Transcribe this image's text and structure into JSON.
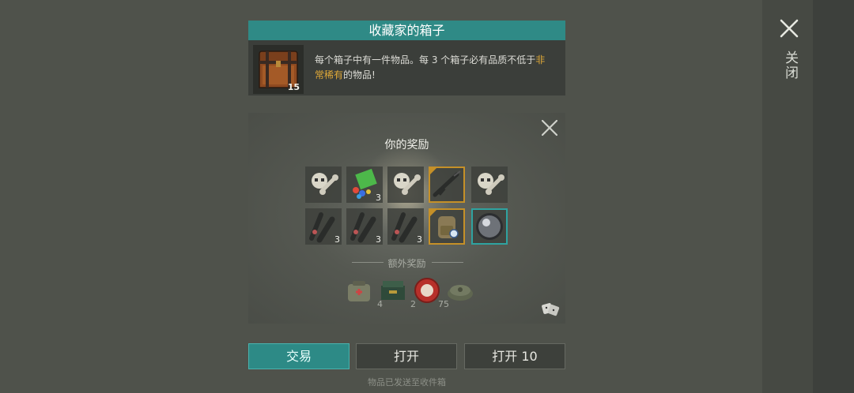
{
  "close": {
    "label": "关闭"
  },
  "chest": {
    "title": "收藏家的箱子",
    "count": "15",
    "desc_part1": "每个箱子中有一件物品。每 3 个箱子必有品质不低于",
    "desc_highlight": "非常稀有",
    "desc_part2": "的物品!"
  },
  "rewards": {
    "title": "你的奖励",
    "items": [
      {
        "icon": "skull-bone-icon",
        "count": ""
      },
      {
        "icon": "gems-book-icon",
        "count": "3"
      },
      {
        "icon": "skull-bone-icon",
        "count": ""
      },
      {
        "icon": "rifle-icon",
        "count": "",
        "rarity": "gold"
      },
      {
        "icon": "skull-bone-icon",
        "count": ""
      },
      {
        "icon": "scope-parts-icon",
        "count": "3"
      },
      {
        "icon": "scope-parts-icon",
        "count": "3"
      },
      {
        "icon": "scope-parts-icon",
        "count": "3"
      },
      {
        "icon": "backpack-icon",
        "count": "",
        "rarity": "gold"
      },
      {
        "icon": "lens-icon",
        "count": "",
        "rarity": "teal"
      }
    ],
    "bonus_label": "额外奖励",
    "bonus": [
      {
        "icon": "medkit-bag-icon",
        "count": "4"
      },
      {
        "icon": "ammo-crate-icon",
        "count": "2"
      },
      {
        "icon": "bottle-cap-icon",
        "count": "75"
      },
      {
        "icon": "landmine-icon",
        "count": ""
      }
    ]
  },
  "buttons": {
    "trade": "交易",
    "open": "打开",
    "open10": "打开 10"
  },
  "footer": "物品已发送至收件箱",
  "colors": {
    "accent": "#2f8a86",
    "rare_gold": "#c59028",
    "rare_teal": "#2fa3a0",
    "highlight": "#e0a938"
  }
}
